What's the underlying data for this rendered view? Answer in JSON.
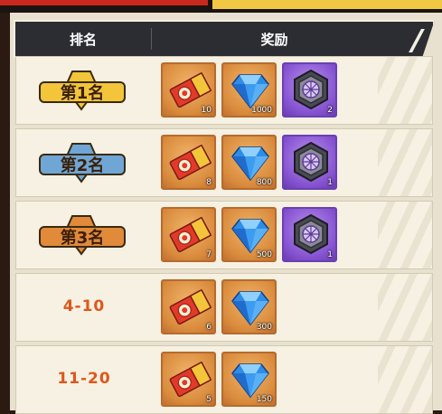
{
  "header": {
    "rank_label": "排名",
    "reward_label": "奖励"
  },
  "rows": [
    {
      "rank": "第1名",
      "badge": "gold",
      "items": [
        {
          "icon": "ticket-icon",
          "count": "10"
        },
        {
          "icon": "diamond-icon",
          "count": "1000"
        },
        {
          "icon": "web-emblem-icon",
          "count": "2"
        }
      ]
    },
    {
      "rank": "第2名",
      "badge": "silver",
      "items": [
        {
          "icon": "ticket-icon",
          "count": "8"
        },
        {
          "icon": "diamond-icon",
          "count": "800"
        },
        {
          "icon": "web-emblem-icon",
          "count": "1"
        }
      ]
    },
    {
      "rank": "第3名",
      "badge": "bronze",
      "items": [
        {
          "icon": "ticket-icon",
          "count": "7"
        },
        {
          "icon": "diamond-icon",
          "count": "500"
        },
        {
          "icon": "web-emblem-icon",
          "count": "1"
        }
      ]
    },
    {
      "rank": "4-10",
      "items": [
        {
          "icon": "ticket-icon",
          "count": "6"
        },
        {
          "icon": "diamond-icon",
          "count": "300"
        }
      ]
    },
    {
      "rank": "11-20",
      "items": [
        {
          "icon": "ticket-icon",
          "count": "5"
        },
        {
          "icon": "diamond-icon",
          "count": "150"
        }
      ]
    }
  ],
  "colors": {
    "gold": "#f2c53a",
    "silver": "#6fa6d6",
    "bronze": "#e08a3a",
    "rank_text": "#e0561a"
  }
}
